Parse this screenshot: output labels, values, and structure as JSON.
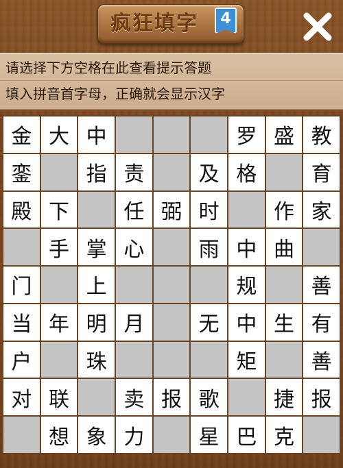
{
  "header": {
    "title": "疯狂填字",
    "level": "4",
    "close_icon": "close-icon"
  },
  "hint": {
    "line1": "请选择下方空格在此查看提示答题",
    "line2": "填入拼音首字母，正确就会显示汉字"
  },
  "colors": {
    "wood": "#7a4620",
    "cell_filled": "#ffffff",
    "cell_empty": "#c4c4c4",
    "badge": "#3d8fd6"
  },
  "grid": {
    "rows": [
      [
        "金",
        "大",
        "中",
        "",
        "",
        "",
        "罗",
        "盛",
        "教"
      ],
      [
        "銮",
        "",
        "指",
        "责",
        "",
        "及",
        "格",
        "",
        "育"
      ],
      [
        "殿",
        "下",
        "",
        "任",
        "弼",
        "时",
        "",
        "作",
        "家"
      ],
      [
        "",
        "手",
        "掌",
        "心",
        "",
        "雨",
        "中",
        "曲",
        ""
      ],
      [
        "门",
        "",
        "上",
        "",
        "",
        "",
        "规",
        "",
        "善"
      ],
      [
        "当",
        "年",
        "明",
        "月",
        "",
        "无",
        "中",
        "生",
        "有"
      ],
      [
        "户",
        "",
        "珠",
        "",
        "",
        "",
        "矩",
        "",
        "善"
      ],
      [
        "对",
        "联",
        "",
        "卖",
        "报",
        "歌",
        "",
        "捷",
        "报"
      ],
      [
        "",
        "想",
        "象",
        "力",
        "",
        "星",
        "巴",
        "克",
        ""
      ]
    ]
  }
}
